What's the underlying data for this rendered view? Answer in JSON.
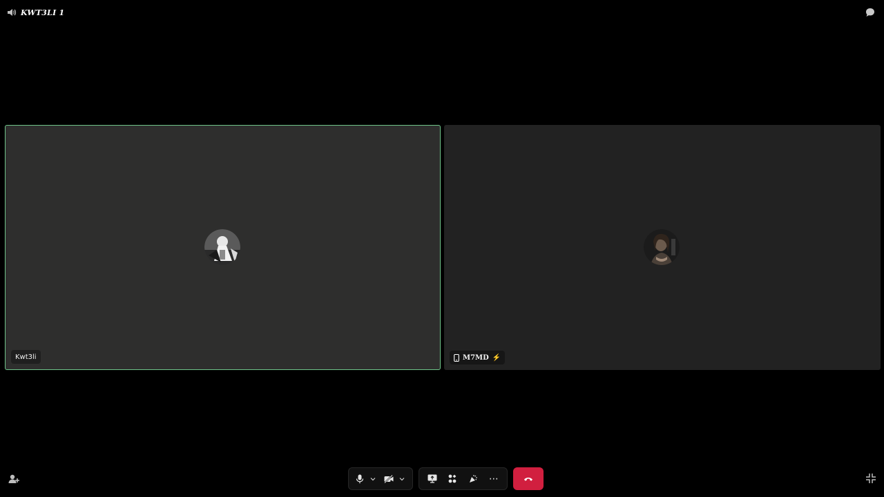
{
  "header": {
    "channel_title": "KWT3LI 1"
  },
  "participants": [
    {
      "name": "Kwt3li",
      "speaking": true,
      "avatar_icon": "user-avatar-icon"
    },
    {
      "name": "M7MD",
      "device_icon": "mobile-phone-icon",
      "badge": "⚡",
      "avatar_icon": "user-avatar-icon"
    }
  ],
  "controls": {
    "microphone": "microphone-icon",
    "camera_off": "camera-off-icon",
    "screen_share": "screen-share-icon",
    "activities": "activities-icon",
    "soundboard": "soundboard-icon",
    "more": "⋯",
    "end_call": "end-call-icon"
  },
  "colors": {
    "background": "#000000",
    "tile_left": "#2e2e2d",
    "tile_right": "#222222",
    "speaking_border": "#6fc58a",
    "end_call": "#d11f3f"
  }
}
